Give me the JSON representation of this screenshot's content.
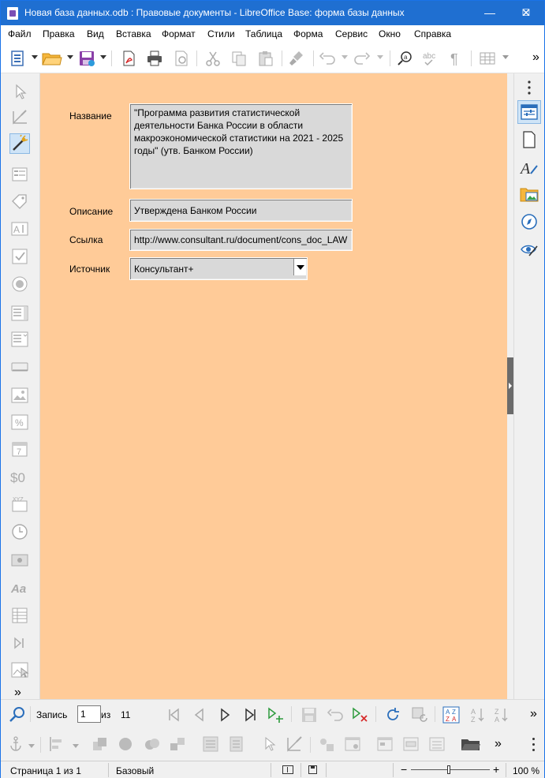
{
  "window": {
    "title": "Новая база данных.odb : Правовые документы - LibreOffice Base: форма базы данных",
    "minimize": "—",
    "maximize": "☐",
    "close": "✕"
  },
  "menu": [
    "Файл",
    "Правка",
    "Вид",
    "Вставка",
    "Формат",
    "Стили",
    "Таблица",
    "Форма",
    "Сервис",
    "Окно",
    "Справка"
  ],
  "form": {
    "fields": {
      "name_label": "Название",
      "name_value": "\"Программа развития статистической\nдеятельности Банка России в области\nмакроэкономической статистики на 2021 - 2025\nгоды\" (утв. Банком России)",
      "description_label": "Описание",
      "description_value": "Утверждена Банком России",
      "link_label": "Ссылка",
      "link_value": "http://www.consultant.ru/document/cons_doc_LAW",
      "source_label": "Источник",
      "source_value": "Консультант+"
    },
    "background_color": "#ffcb98"
  },
  "navigation": {
    "record_label": "Запись",
    "record_current": "1",
    "of_label": "из",
    "record_total": "11"
  },
  "overflow_glyph": "»",
  "status": {
    "page": "Страница 1 из 1",
    "page_style": "Базовый",
    "zoom": "100 %",
    "zoom_minus": "−",
    "zoom_plus": "+"
  }
}
